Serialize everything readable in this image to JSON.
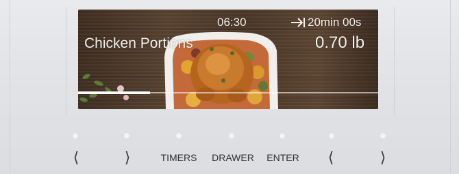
{
  "display": {
    "clock": "06:30",
    "timer": {
      "icon": "timer-end-icon",
      "value": "20min 00s"
    },
    "food_name": "Chicken Portions",
    "weight": "0.70 lb",
    "progress_fraction": 0.24,
    "background_image": "roast-chicken-dish-on-wood"
  },
  "buttons": {
    "left_prev": "⟨",
    "left_next": "⟩",
    "timers": "TIMERS",
    "drawer": "DRAWER",
    "enter": "ENTER",
    "right_prev": "⟨",
    "right_next": "⟩"
  },
  "colors": {
    "panel": "#e2e3e6",
    "screen_text": "#f4f2ee",
    "button_text": "#2f3033",
    "wood": "#5a4331"
  }
}
